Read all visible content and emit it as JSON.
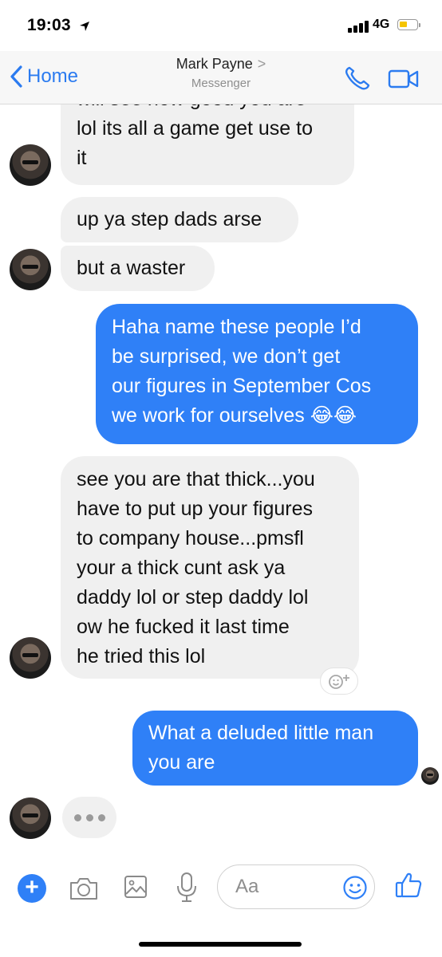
{
  "status_bar": {
    "time": "19:03",
    "network": "4G"
  },
  "header": {
    "back_label": "Home",
    "contact_name": "Mark Payne",
    "contact_chevron": ">",
    "contact_subtitle": "Messenger"
  },
  "messages": [
    {
      "from": "them",
      "lines": [
        "will see how good you are",
        "lol its all a game get use to",
        "it"
      ]
    },
    {
      "from": "them",
      "lines": [
        "up ya step dads arse"
      ]
    },
    {
      "from": "them",
      "lines": [
        "but a waster"
      ]
    },
    {
      "from": "me",
      "lines": [
        "Haha name these people I’d",
        "be surprised, we don’t get",
        "our figures in September Cos",
        "we work for ourselves 😂😂"
      ]
    },
    {
      "from": "them",
      "lines": [
        "see you are that thick...you",
        "have to put up your figures",
        "to company house...pmsfl",
        "your a thick cunt ask ya",
        "daddy lol or step daddy lol",
        "ow he fucked it last time",
        "he tried this lol"
      ]
    },
    {
      "from": "me",
      "lines": [
        "What a deluded little man",
        "you are"
      ]
    }
  ],
  "composer": {
    "placeholder": "Aa"
  },
  "colors": {
    "accent": "#2f80f7",
    "incoming_bubble": "#f0f0f0",
    "outgoing_bubble": "#2f80f7"
  },
  "icons": [
    "location-arrow-icon",
    "signal-icon",
    "battery-icon",
    "back-chevron-icon",
    "phone-icon",
    "video-icon",
    "plus-icon",
    "camera-icon",
    "image-icon",
    "microphone-icon",
    "emoji-icon",
    "thumbs-up-icon",
    "add-reaction-icon"
  ]
}
